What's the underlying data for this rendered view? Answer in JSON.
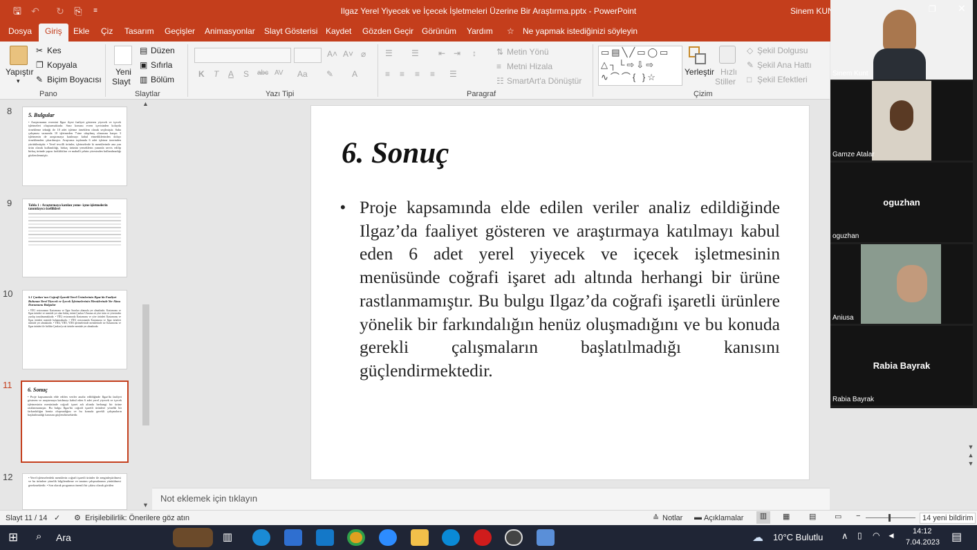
{
  "titlebar": {
    "title": "Ilgaz Yerel Yiyecek ve İçecek İşletmeleri Üzerine Bir Araştırma.pptx  -  PowerPoint",
    "user": "Sinem KUNT",
    "quick_access": [
      "save-icon",
      "undo-icon",
      "redo-icon",
      "present-icon",
      "customize-icon"
    ]
  },
  "tabs": [
    "Dosya",
    "Giriş",
    "Ekle",
    "Çiz",
    "Tasarım",
    "Geçişler",
    "Animasyonlar",
    "Slayt Gösterisi",
    "Kaydet",
    "Gözden Geçir",
    "Görünüm",
    "Yardım"
  ],
  "tell_me": "Ne yapmak istediğinizi söyleyin",
  "ribbon": {
    "pano": {
      "paste": "Yapıştır",
      "cut": "Kes",
      "copy": "Kopyala",
      "format_painter": "Biçim Boyacısı",
      "label": "Pano"
    },
    "slaytlar": {
      "new_slide_1": "Yeni",
      "new_slide_2": "Slayt",
      "layout": "Düzen",
      "reset": "Sıfırla",
      "section": "Bölüm",
      "label": "Slaytlar"
    },
    "yazi_tipi": {
      "label": "Yazı Tipi",
      "buttons": [
        "K",
        "T",
        "A",
        "S",
        "abc",
        "AV",
        "Aa"
      ]
    },
    "paragraf": {
      "label": "Paragraf",
      "text_direction": "Metin Yönü",
      "align_text": "Metni Hizala",
      "smartart": "SmartArt'a Dönüştür"
    },
    "cizim": {
      "arrange_1": "Yerleştir",
      "quick_styles_1": "Hızlı",
      "quick_styles_2": "Stiller",
      "shape_fill": "Şekil Dolgusu",
      "shape_outline": "Şekil Ana Hattı",
      "shape_effects": "Şekil Efektleri",
      "label": "Çizim"
    }
  },
  "thumbnails": [
    {
      "num": "8",
      "title": "5. Bulgular",
      "text": "• Araştırmanın evrenini Ilgaz ilçesi faaliyet gösteren yiyecek ve içecek işletmeleri oluşturmaktadır. Sınır konusu evren içerisinden kolayda örnekleme tekniği ile 10 adet işletme örneklem olarak seçilmiştir. Saha çalışması sırasında 10 işletmeden 7'sine ulaşılmış olmasına karşın 3 işletmenin de araştırmaya katılmayı kabul etmediklerinden dolayı örneklemden çıkarılmıştır. Araştırma toplamda 6 adet işletme üzerinden yürütülmüştür. • Yerel tescilli ürünler, işletmelerde ki menülerinde ana yan ürün olarak kullanıldığı, birkaç ürünün yemeklerin yanında servis edilip birkaç üründe yapısı farklılıkları ve mahalli şehrin yöresinden kullanılmadığı gözlemlenmiştir."
    },
    {
      "num": "9",
      "title": "Tablo 1 : Araştırmaya katılan yeme- içme işletmelerin tanımlayıcı özellikleri",
      "text": ""
    },
    {
      "num": "10",
      "title": "5.1 Çankırı'nın Coğrafi İşaretli Yerel Ürünlerinin Ilgaz'da Faaliyet Bulunan Yerel Yiyecek ve İçecek İşletmelerinin Menülerinde Yer Alma Durumunu Bulgular",
      "text": "• YİE1 restoranının Kastamonu ve Ilgaz Sınırları alanında yer almaktadır. Kastamonu ve Ilgaz ürünleri ve menüde yer alan birkaç ürünü Çankırı Ulusuna ait yöre ürün ve yöresinden yazılıp tanıtılmamaktadır. • YİE2 restoranında Kastamonu ve yöre ürünleri Kastamonu ve Ilgaz ürünleri menüde bulunmaktadır. • YİE3 restoranında Kastamonu ve Ilgaz ürünleri menüde yer almaktadır. • YİE4, YİE5, YİE6 işletmelerinde menülerinde ise Kastamonu ve Ilgaz ürünleri ile birlikte Çankırı'ya ait ürünler menüde yer almaktadır."
    },
    {
      "num": "11",
      "title": "6. Sonuç",
      "text": "• Proje kapsamında elde edilen veriler analiz edildiğinde Ilgaz'da faaliyet gösteren ve araştırmaya katılmayı kabul eden 6 adet yerel yiyecek ve içecek işletmesinin menüsünde coğrafi işaret adı altında herhangi bir ürüne rastlanmamıştır. Bu bulgu Ilgaz'da coğrafi işaretli ürünlere yönelik bir farkındalığın henüz oluşmadığını ve bu konuda gerekli çalışmaların başlatılmadığı kanısını güçlendirmektedir."
    },
    {
      "num": "12",
      "title": "",
      "text": "• Yerel işletmelerdeki menülerin coğrafi işaretli ürünler ile zenginleştirilmesi ve bu ürünlere yönelik bilgilendirme ve tanıtım çalışmalarının yürütülmesi gerekmektedir. • Son olarak programın önemli bir çıktısı olarak görülen"
    }
  ],
  "slide": {
    "title": "6. Sonuç",
    "body": "Proje kapsamında elde edilen veriler analiz edildiğinde Ilgaz’da faaliyet gösteren ve araştırmaya katılmayı kabul eden 6 adet yerel yiyecek ve içecek işletmesinin menüsünde coğrafi işaret adı altında herhangi bir ürüne rastlanmamıştır. Bu bulgu Ilgaz’da coğrafi işaretli ürünlere yönelik bir farkındalığın henüz oluşmadığını ve bu konuda gerekli çalışmaların başlatılmadığı kanısını güçlendirmektedir.",
    "bullet": "•"
  },
  "notes_placeholder": "Not eklemek için tıklayın",
  "status": {
    "slide_count": "Slayt 11 / 14",
    "accessibility": "Erişilebilirlik: Önerilere göz atın",
    "notes": "Notlar",
    "comments": "Açıklamalar",
    "notifications": "14 yeni bildirim"
  },
  "taskbar": {
    "search": "Ara",
    "weather": "10°C  Bulutlu",
    "time": "14:12",
    "date": "7.04.2023"
  },
  "participants": [
    {
      "name": "Sinem Kunt",
      "video": true
    },
    {
      "name": "Gamze Atalar",
      "video": true
    },
    {
      "name": "oguzhan",
      "video": false,
      "center": "oguzhan"
    },
    {
      "name": "Aniusa",
      "video": true
    },
    {
      "name": "Rabia Bayrak",
      "video": false,
      "center": "Rabia Bayrak"
    }
  ],
  "colors": {
    "accent": "#c43e1c",
    "taskbar": "#1f2535"
  }
}
